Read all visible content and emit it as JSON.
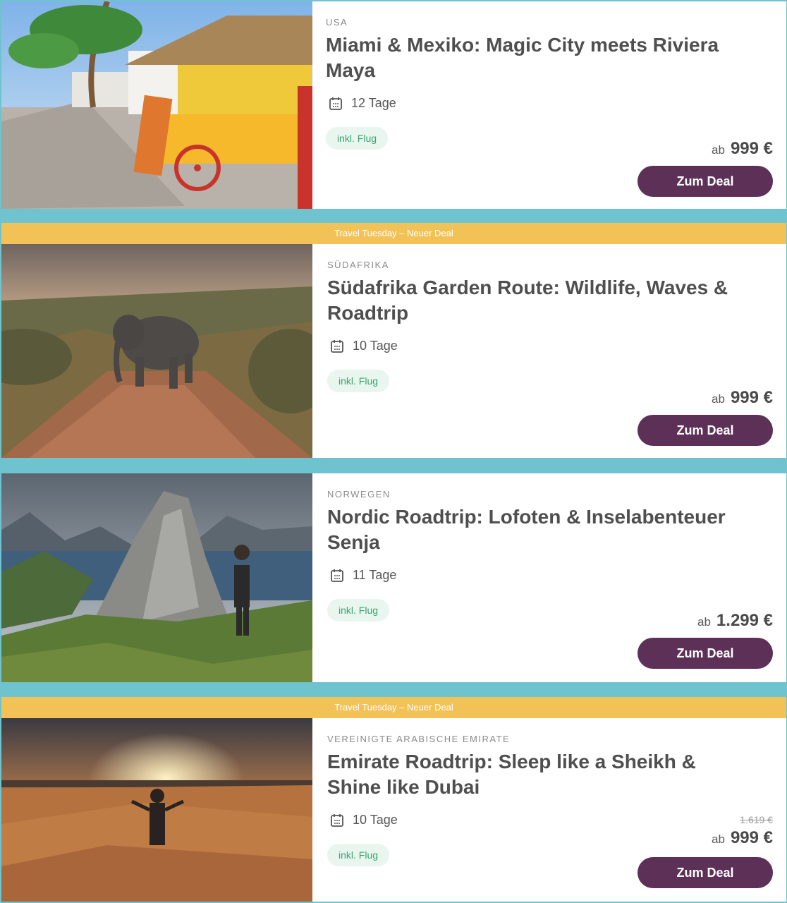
{
  "deals": [
    {
      "country": "USA",
      "title": "Miami & Mexiko: Magic City meets Riviera Maya",
      "duration": "12 Tage",
      "badge": "inkl. Flug",
      "price_prefix": "ab",
      "price": "999 €",
      "old_price": "",
      "button_label": "Zum Deal",
      "image": "beach-kiosk-photo"
    },
    {
      "banner": "Travel Tuesday – Neuer Deal",
      "country": "Südafrika",
      "title": "Südafrika Garden Route: Wildlife, Waves & Roadtrip",
      "duration": "10 Tage",
      "badge": "inkl. Flug",
      "price_prefix": "ab",
      "price": "999 €",
      "old_price": "",
      "button_label": "Zum Deal",
      "image": "elephant-road-photo"
    },
    {
      "country": "Norwegen",
      "title": "Nordic Roadtrip: Lofoten & Inselabenteuer Senja",
      "duration": "11 Tage",
      "badge": "inkl. Flug",
      "price_prefix": "ab",
      "price": "1.299 €",
      "old_price": "",
      "button_label": "Zum Deal",
      "image": "fjord-mountain-photo"
    },
    {
      "banner": "Travel Tuesday – Neuer Deal",
      "country": "Vereinigte Arabische Emirate",
      "title": "Emirate Roadtrip: Sleep like a Sheikh & Shine like Dubai",
      "duration": "10 Tage",
      "badge": "inkl. Flug",
      "price_prefix": "ab",
      "price": "999 €",
      "old_price": "1.619 €",
      "button_label": "Zum Deal",
      "image": "desert-sunset-photo"
    }
  ],
  "colors": {
    "separator": "#6ec3cf",
    "banner": "#f2c257",
    "button": "#5d3058",
    "badge_bg": "#e9f6ef",
    "badge_text": "#3aa36e"
  }
}
